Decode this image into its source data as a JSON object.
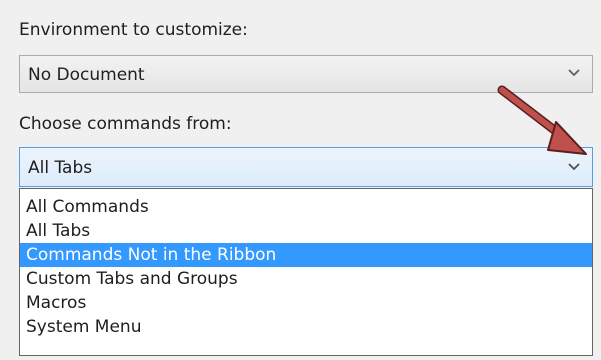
{
  "environment": {
    "label": "Environment to customize:",
    "selected": "No Document"
  },
  "commands": {
    "label": "Choose commands from:",
    "selected": "All Tabs",
    "options": [
      "All Commands",
      "All Tabs",
      "Commands Not in the Ribbon",
      "Custom Tabs and Groups",
      "Macros",
      "System Menu"
    ],
    "highlighted_index": 2
  },
  "colors": {
    "highlight": "#3399ff",
    "annotation_arrow": "#c0504d"
  },
  "icons": {
    "dropdown": "chevron-down-icon",
    "annotation": "arrow-pointer-icon"
  }
}
